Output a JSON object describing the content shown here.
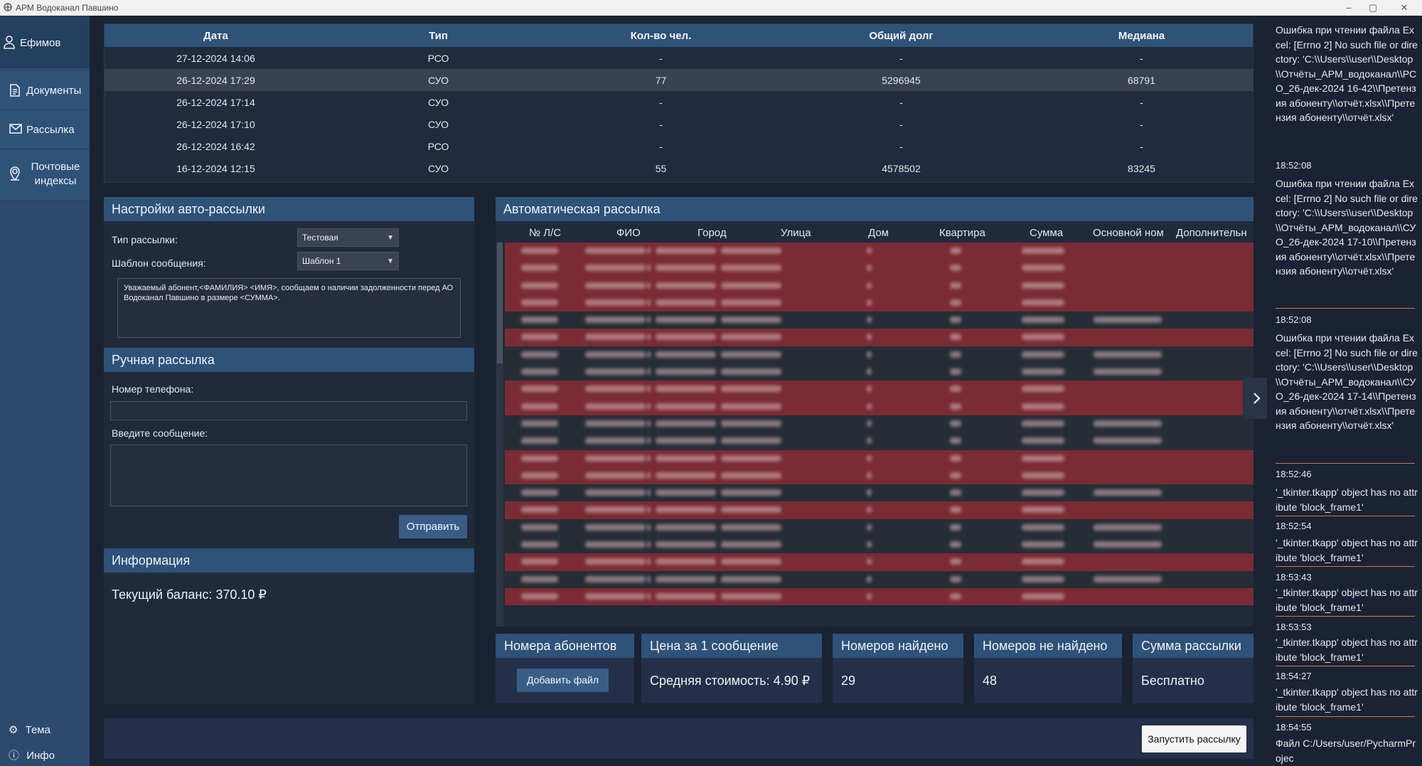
{
  "window": {
    "title": "АРМ Водоканал Павшино",
    "buttons": [
      "–",
      "▢",
      "✕"
    ]
  },
  "sidebar": {
    "user": "Ефимов",
    "items": [
      {
        "label": "Документы",
        "icon": "document-icon"
      },
      {
        "label": "Рассылка",
        "icon": "mail-icon"
      },
      {
        "label": "Почтовые индексы",
        "icon": "location-icon"
      }
    ],
    "bottom": [
      {
        "label": "Тема",
        "icon": "gear-icon"
      },
      {
        "label": "Инфо",
        "icon": "info-icon"
      }
    ]
  },
  "history": {
    "columns": [
      "Дата",
      "Тип",
      "Кол-во чел.",
      "Общий долг",
      "Медиана"
    ],
    "rows": [
      [
        "27-12-2024 14:06",
        "РСО",
        "-",
        "-",
        "-"
      ],
      [
        "26-12-2024 17:29",
        "СУО",
        "77",
        "5296945",
        "68791"
      ],
      [
        "26-12-2024 17:14",
        "СУО",
        "-",
        "-",
        "-"
      ],
      [
        "26-12-2024 17:10",
        "СУО",
        "-",
        "-",
        "-"
      ],
      [
        "26-12-2024 16:42",
        "РСО",
        "-",
        "-",
        "-"
      ],
      [
        "16-12-2024 12:15",
        "СУО",
        "55",
        "4578502",
        "83245"
      ]
    ],
    "selected_row": 1
  },
  "auto_settings": {
    "title": "Настройки авто-рассылки",
    "type_label": "Тип рассылки:",
    "type_value": "Тестовая",
    "template_label": "Шаблон сообщения:",
    "template_value": "Шаблон 1",
    "template_text": "Уважаемый абонент,<ФАМИЛИЯ> <ИМЯ>, сообщаем о наличии задолженности перед АО Водоканал Павшино в размере <СУММА>."
  },
  "manual": {
    "title": "Ручная рассылка",
    "phone_label": "Номер телефона:",
    "message_label": "Введите сообщение:",
    "send_label": "Отправить"
  },
  "info": {
    "title": "Информация",
    "balance": "Текущий баланс: 370.10 ₽"
  },
  "auto_list": {
    "title": "Автоматическая рассылка",
    "columns": [
      "№ Л/С",
      "ФИО",
      "Город",
      "Улица",
      "Дом",
      "Квартира",
      "Сумма",
      "Основной ном",
      "Дополнительн"
    ],
    "row_status": [
      "red",
      "red",
      "red",
      "red",
      "dark",
      "red",
      "dark",
      "dark",
      "red",
      "red",
      "dark",
      "dark",
      "red",
      "red",
      "dark",
      "red",
      "dark",
      "dark",
      "red",
      "dark",
      "red"
    ],
    "row_has_phone": [
      false,
      false,
      false,
      false,
      true,
      false,
      true,
      true,
      false,
      false,
      true,
      true,
      false,
      false,
      true,
      false,
      true,
      true,
      false,
      true,
      false
    ]
  },
  "cards": {
    "numbers": {
      "title": "Номера абонентов",
      "button": "Добавить файл"
    },
    "price": {
      "title": "Цена за 1 сообщение",
      "value": "Средняя стоимость: 4.90 ₽"
    },
    "found": {
      "title": "Номеров найдено",
      "value": "29"
    },
    "not_found": {
      "title": "Номеров не найдено",
      "value": "48"
    },
    "sum": {
      "title": "Сумма рассылки",
      "value": "Бесплатно"
    }
  },
  "launch_label": "Запустить рассылку",
  "log": {
    "entries": [
      {
        "msg": "Ошибка при чтении файла Excel: [Errno 2] No such file or directory: 'C:\\\\Users\\\\user\\\\Desktop\\\\Отчёты_АРМ_водоканал\\\\РСО_26-дек-2024 16-42\\\\Претензия абоненту\\\\отчёт.xlsx\\\\Претензия абоненту\\\\отчёт.xlsx'",
        "time": "18:52:08"
      },
      {
        "msg": "Ошибка при чтении файла Excel: [Errno 2] No such file or directory: 'C:\\\\Users\\\\user\\\\Desktop\\\\Отчёты_АРМ_водоканал\\\\СУО_26-дек-2024 17-10\\\\Претензия абоненту\\\\отчёт.xlsx\\\\Претензия абоненту\\\\отчёт.xlsx'",
        "time": "18:52:08"
      },
      {
        "msg": "Ошибка при чтении файла Excel: [Errno 2] No such file or directory: 'C:\\\\Users\\\\user\\\\Desktop\\\\Отчёты_АРМ_водоканал\\\\СУО_26-дек-2024 17-14\\\\Претензия абоненту\\\\отчёт.xlsx\\\\Претензия абоненту\\\\отчёт.xlsx'",
        "time": "18:52:46"
      },
      {
        "msg": "'_tkinter.tkapp' object has no attribute 'block_frame1'",
        "time": "18:52:54"
      },
      {
        "msg": "'_tkinter.tkapp' object has no attribute 'block_frame1'",
        "time": "18:53:43"
      },
      {
        "msg": "'_tkinter.tkapp' object has no attribute 'block_frame1'",
        "time": "18:53:53"
      },
      {
        "msg": "'_tkinter.tkapp' object has no attribute 'block_frame1'",
        "time": "18:54:27"
      },
      {
        "msg": "'_tkinter.tkapp' object has no attribute 'block_frame1'",
        "time": "18:54:55"
      },
      {
        "msg": "Файл C:/Users/user/PycharmProjec",
        "time": ""
      }
    ]
  },
  "colors": {
    "accent": "#2f5278",
    "sidebar": "#2d4a6e",
    "row_red": "#7a2b34",
    "row_dark": "#272d37",
    "log_separator": "#c97c3d"
  }
}
